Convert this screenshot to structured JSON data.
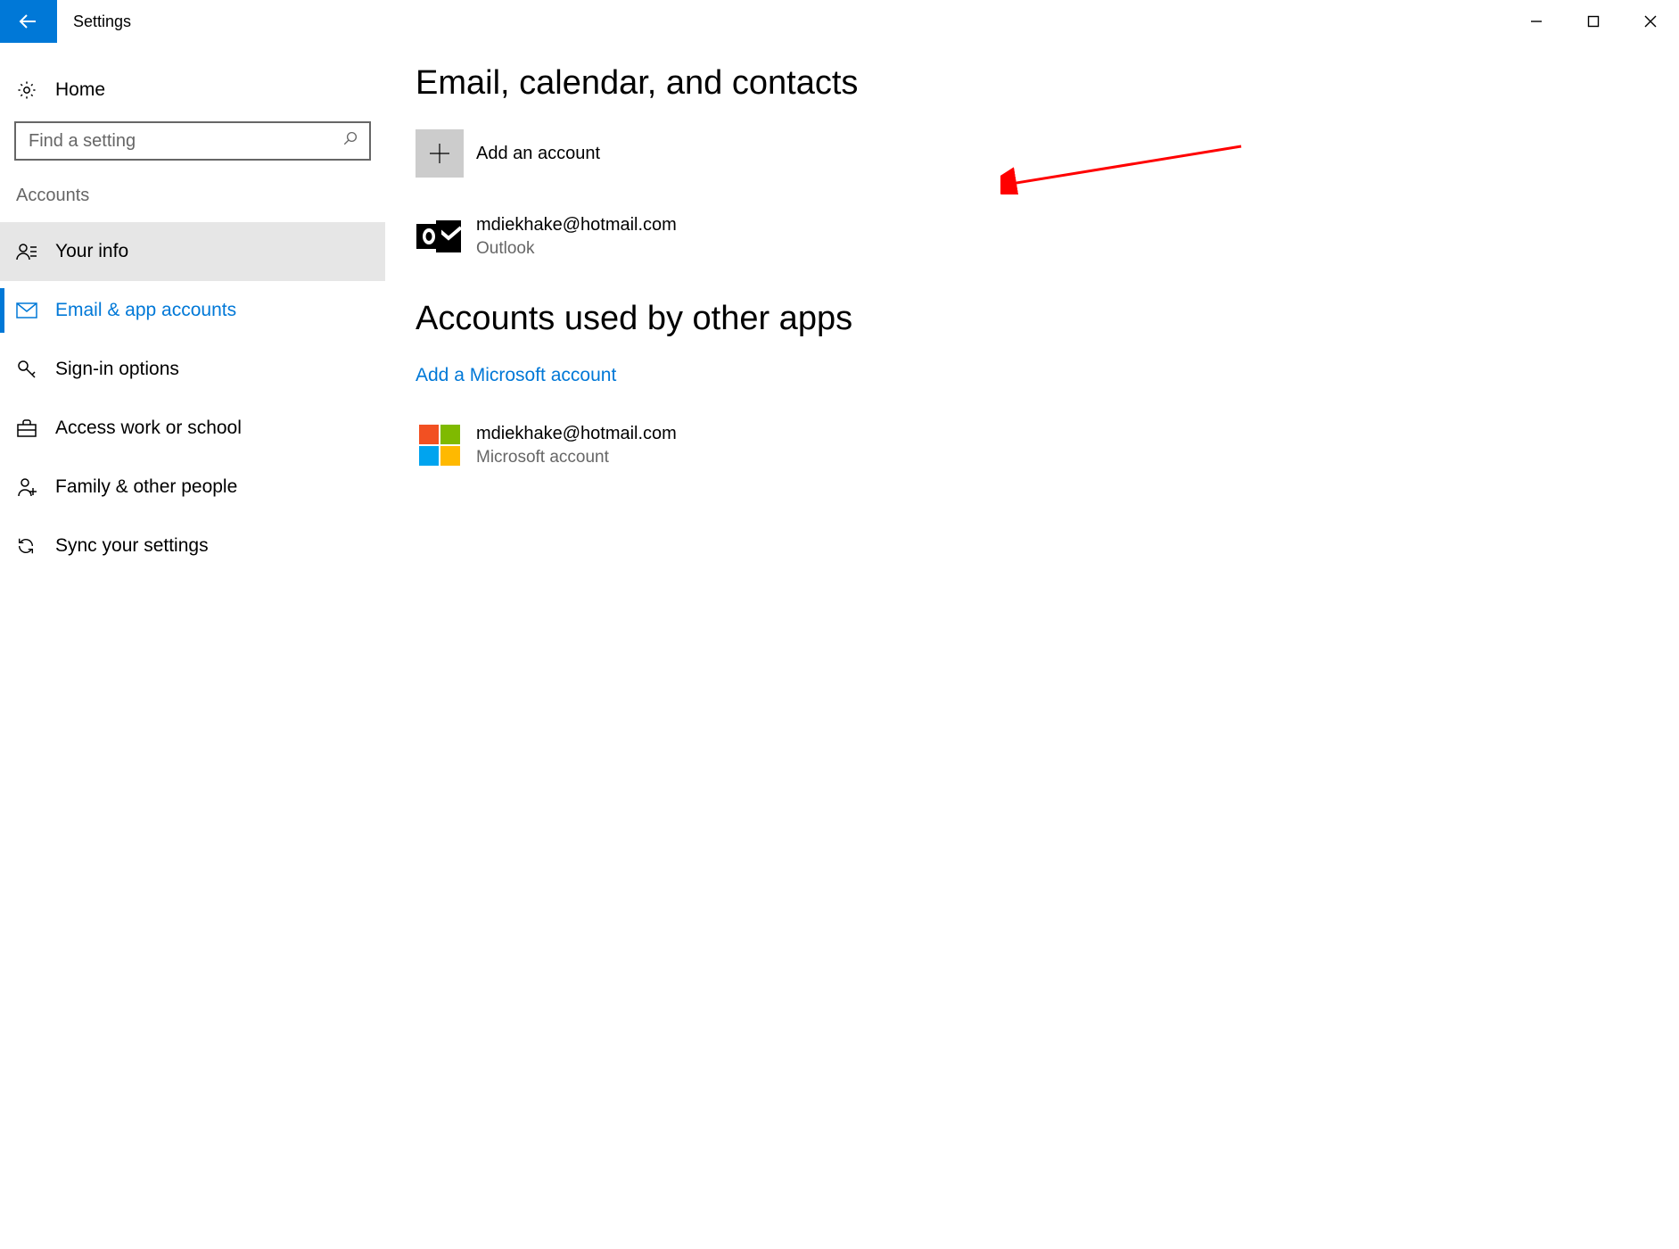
{
  "window": {
    "title": "Settings"
  },
  "sidebar": {
    "home_label": "Home",
    "search_placeholder": "Find a setting",
    "section_label": "Accounts",
    "items": [
      {
        "icon": "person-icon",
        "label": "Your info",
        "state": "selected"
      },
      {
        "icon": "mail-icon",
        "label": "Email & app accounts",
        "state": "active"
      },
      {
        "icon": "key-icon",
        "label": "Sign-in options",
        "state": "normal"
      },
      {
        "icon": "briefcase-icon",
        "label": "Access work or school",
        "state": "normal"
      },
      {
        "icon": "family-icon",
        "label": "Family & other people",
        "state": "normal"
      },
      {
        "icon": "sync-icon",
        "label": "Sync your settings",
        "state": "normal"
      }
    ]
  },
  "content": {
    "section1_title": "Email, calendar, and contacts",
    "add_account_label": "Add an account",
    "accounts": [
      {
        "email": "mdiekhake@hotmail.com",
        "provider": "Outlook"
      }
    ],
    "section2_title": "Accounts used by other apps",
    "add_ms_account_label": "Add a Microsoft account",
    "ms_accounts": [
      {
        "email": "mdiekhake@hotmail.com",
        "provider": "Microsoft account"
      }
    ]
  },
  "colors": {
    "accent": "#0078d7",
    "ms_logo": [
      "#f25022",
      "#7fba00",
      "#00a4ef",
      "#ffb900"
    ]
  }
}
